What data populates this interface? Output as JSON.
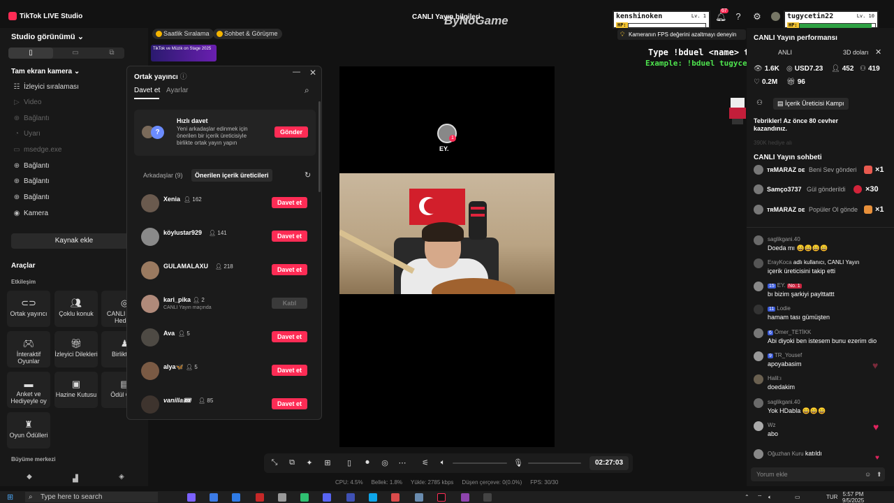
{
  "titlebar": {
    "app_title": "TikTok LIVE Studio",
    "live_title": "CANLI Yayın bilgileri",
    "watermark": "ByNoGame",
    "notif_count": "67",
    "icons": [
      "bell-icon",
      "help-icon",
      "settings-icon"
    ]
  },
  "game_cards": [
    {
      "name": "kenshinoken",
      "level": "Lv. 1",
      "hp_label": "HP:",
      "hp": 0.0
    },
    {
      "name": "tugycetin22",
      "level": "Lv. 10",
      "hp_label": "HP:",
      "hp": 0.95
    }
  ],
  "left": {
    "studio_view": "Studio görünümü",
    "fullscreen": "Tam ekran kamera",
    "sources": [
      {
        "label": "İzleyici sıralaması",
        "icon": "ranking-icon",
        "dim": false
      },
      {
        "label": "Video",
        "icon": "play-icon",
        "dim": true
      },
      {
        "label": "Bağlantı",
        "icon": "link-icon",
        "dim": true
      },
      {
        "label": "Uyarı",
        "icon": "bell-icon",
        "dim": true
      },
      {
        "label": "msedge.exe",
        "icon": "window-icon",
        "dim": true
      },
      {
        "label": "Bağlantı",
        "icon": "globe-icon",
        "dim": false
      },
      {
        "label": "Bağlantı",
        "icon": "globe-icon",
        "dim": false
      },
      {
        "label": "Bağlantı",
        "icon": "globe-icon",
        "dim": false
      },
      {
        "label": "Kamera",
        "icon": "camera-icon",
        "dim": false
      }
    ],
    "add_source": "Kaynak ekle",
    "tools_title": "Araçlar",
    "engagement": "Etkileşim",
    "tools": [
      {
        "label": "Ortak yayıncı",
        "icon": "co-host-icon"
      },
      {
        "label": "Çoklu konuk",
        "icon": "multi-guest-icon"
      },
      {
        "label": "CANLI Yayın Hede...",
        "icon": "target-icon"
      },
      {
        "label": "İnteraktif Oyunlar",
        "icon": "gamepad-icon"
      },
      {
        "label": "İzleyici Dilekleri",
        "icon": "gift-icon"
      },
      {
        "label": "Birlikte ...",
        "icon": "together-icon"
      },
      {
        "label": "Anket ve Hediyeyle oy",
        "icon": "poll-icon"
      },
      {
        "label": "Hazine Kutusu",
        "icon": "treasure-icon"
      },
      {
        "label": "Ödül Ça...",
        "icon": "reward-icon"
      },
      {
        "label": "Oyun Ödülleri",
        "icon": "trophy-icon"
      }
    ],
    "growth": "Büyüme merkezi"
  },
  "top_pills": [
    "Saatlik Sıralama",
    "Sohbet & Görüşme"
  ],
  "promo_text": "TikTok ve Müzik on Stage 2025",
  "dialog": {
    "title": "Ortak yayıncı",
    "tab_invite": "Davet et",
    "tab_settings": "Ayarlar",
    "quick_title": "Hızlı davet",
    "quick_desc": "Yeni arkadaşlar edinmek için önerilen bir içerik üreticisiyle birlikte ortak yayın yapın",
    "quick_badge": "?",
    "send": "Gönder",
    "friends_tab": "Arkadaşlar (9)",
    "suggested_tab": "Önerilen içerik üreticileri",
    "hosts": [
      {
        "name": "Xenia",
        "count": "162",
        "sub": "",
        "action": "Davet et",
        "joined": false
      },
      {
        "name": "köylustar929",
        "count": "141",
        "sub": "",
        "action": "Davet et",
        "joined": false
      },
      {
        "name": "GULAMALAXU",
        "count": "218",
        "sub": "",
        "action": "Davet et",
        "joined": false
      },
      {
        "name": "kari_pika",
        "count": "2",
        "sub": "CANLI Yayın maçında",
        "action": "Katıl",
        "joined": true
      },
      {
        "name": "Ava",
        "count": "5",
        "sub": "",
        "action": "Davet et",
        "joined": false
      },
      {
        "name": "alya🦋",
        "count": "5",
        "sub": "",
        "action": "Davet et",
        "joined": false
      },
      {
        "name": "vanilla🎟",
        "count": "85",
        "sub": "",
        "action": "Davet et",
        "joined": false
      }
    ]
  },
  "preview": {
    "name_label": "EY.",
    "badge": "1"
  },
  "controls": {
    "timer": "02:27:03"
  },
  "stats": {
    "cpu": "CPU: 4.5%",
    "mem": "Bellek: 1.8%",
    "upload": "Yükle: 2785 kbps",
    "dropped": "Düşen çerçeve: 0(0.0%)",
    "fps": "FPS: 30/30"
  },
  "tip": "Kameranın FPS değerini azaltmayı deneyin",
  "overlay": {
    "command": "Type !bduel <name> to play",
    "example": "Example: !bduel tugycetin22"
  },
  "right": {
    "perf_title": "CANLI Yayın performansı",
    "tip_partial": "ANLI",
    "tip_partial2": "3D doları",
    "metrics": [
      {
        "value": "1.6K",
        "icon": "viewers-icon"
      },
      {
        "value": "USD7.23",
        "icon": "coin-icon"
      },
      {
        "value": "452",
        "icon": "user-icon"
      },
      {
        "value": "419",
        "icon": "new-followers-icon"
      },
      {
        "value": "0.2M",
        "icon": "heart-icon"
      },
      {
        "value": "96",
        "icon": "gift-icon"
      }
    ],
    "campaign": "İçerik Üreticisi Kampı",
    "campaign_text": "Tebrikler! Az önce 80 cevher kazandınız.",
    "campaign_faded": "390K hediye alı",
    "chat_title": "CANLI Yayın sohbeti",
    "gifts": [
      {
        "user": "ᴛʀMARAZ ᴅᴇ",
        "action": "Beni Sev gönderi",
        "mult": "×1"
      },
      {
        "user": "Samço3737",
        "action": "Gül gönderildi",
        "mult": "×30"
      },
      {
        "user": "ᴛʀMARAZ ᴅᴇ",
        "action": "Popüler Ol gönde",
        "mult": "×1"
      }
    ],
    "messages": [
      {
        "user": "saglikgani.40",
        "level": "",
        "text": "Doeda mı 😄😄😄😄"
      },
      {
        "user": "ErayKoca",
        "level": "",
        "text": "adlı kullanıcı, CANLI Yayın"
      },
      {
        "user": "",
        "level": "",
        "text": "içerik üreticisini takip etti"
      },
      {
        "user": "EY.",
        "level": "15",
        "text": "bı bizim şarkiyi paylttattt"
      },
      {
        "user": "Lodie",
        "level": "11",
        "text": "hamam tası gümüşten"
      },
      {
        "user": "Ömer_TETİKK",
        "level": "6",
        "text": "Abi diyoki ben istesem bunu ezerim dio"
      },
      {
        "user": "TR_Yousef",
        "level": "9",
        "text": "apoyabasim"
      },
      {
        "user": "Halil:ı",
        "level": "",
        "text": "doedakim"
      },
      {
        "user": "saglikgani.40",
        "level": "",
        "text": "Yok HDabla 😄😄😄"
      },
      {
        "user": "Wz",
        "level": "",
        "text": "abo"
      },
      {
        "user": "Oğuzhan Kuru",
        "level": "",
        "text": "katıldı"
      }
    ],
    "ey_badge": "No. 1",
    "chat_placeholder": "Yorum ekle"
  },
  "taskbar": {
    "search": "Type here to search",
    "lang": "TUR",
    "time": "5:57 PM",
    "date": "9/5/2025"
  }
}
